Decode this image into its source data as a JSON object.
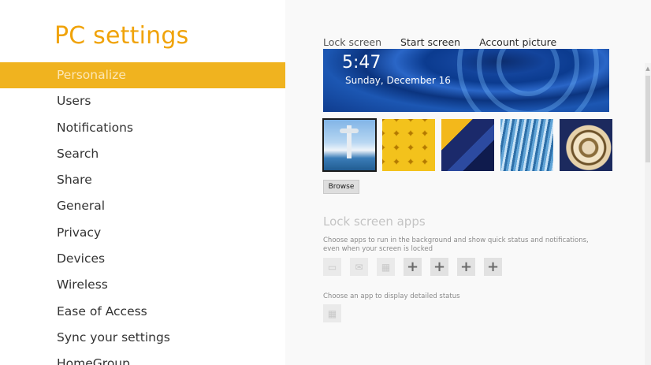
{
  "left": {
    "title": "PC settings",
    "nav_items": [
      {
        "label": "Personalize",
        "selected": true
      },
      {
        "label": "Users",
        "selected": false
      },
      {
        "label": "Notifications",
        "selected": false
      },
      {
        "label": "Search",
        "selected": false
      },
      {
        "label": "Share",
        "selected": false
      },
      {
        "label": "General",
        "selected": false
      },
      {
        "label": "Privacy",
        "selected": false
      },
      {
        "label": "Devices",
        "selected": false
      },
      {
        "label": "Wireless",
        "selected": false
      },
      {
        "label": "Ease of Access",
        "selected": false
      },
      {
        "label": "Sync your settings",
        "selected": false
      },
      {
        "label": "HomeGroup",
        "selected": false
      }
    ]
  },
  "right": {
    "tabs": [
      {
        "label": "Lock screen",
        "active": true
      },
      {
        "label": "Start screen",
        "active": false
      },
      {
        "label": "Account picture",
        "active": false
      }
    ],
    "preview": {
      "time": "5:47",
      "date": "Sunday, December 16"
    },
    "thumbnails": [
      {
        "name": "space-needle",
        "selected": true
      },
      {
        "name": "honeycomb",
        "selected": false
      },
      {
        "name": "geometric",
        "selected": false
      },
      {
        "name": "light-rail",
        "selected": false
      },
      {
        "name": "nautilus-shell",
        "selected": false
      }
    ],
    "browse_label": "Browse",
    "lock_apps": {
      "title": "Lock screen apps",
      "description": "Choose apps to run in the background and show quick status and notifications, even when your screen is locked",
      "slots": [
        {
          "icon": "messaging-icon",
          "glyph": "▭"
        },
        {
          "icon": "mail-icon",
          "glyph": "✉"
        },
        {
          "icon": "calendar-icon",
          "glyph": "▦"
        },
        {
          "icon": "add-icon",
          "glyph": "+"
        },
        {
          "icon": "add-icon",
          "glyph": "+"
        },
        {
          "icon": "add-icon",
          "glyph": "+"
        },
        {
          "icon": "add-icon",
          "glyph": "+"
        }
      ],
      "detailed_description": "Choose an app to display detailed status",
      "detailed_slot_glyph": "▦"
    }
  },
  "colors": {
    "accent": "#f0a30a",
    "selected_nav_bg": "#f0b31f",
    "preview_blue": "#13449c"
  }
}
